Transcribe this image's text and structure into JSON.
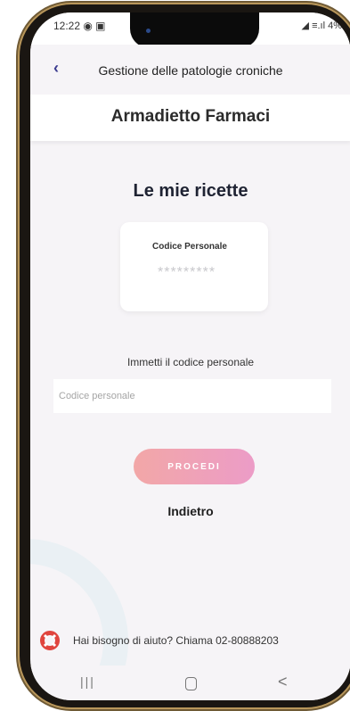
{
  "status_bar": {
    "time": "12:22",
    "indicators": "◉ ▣",
    "right_icons": "◢ ≡.ıl 4%"
  },
  "top_bar": {
    "back_icon": "chevron-left-icon",
    "title": "Gestione delle patologie croniche"
  },
  "header": {
    "title": "Armadietto Farmaci"
  },
  "main": {
    "title": "Le mie ricette",
    "code_card": {
      "label": "Codice Personale",
      "masked_value": "*********"
    },
    "instruction": "Immetti il codice personale",
    "input": {
      "placeholder": "Codice personale",
      "value": ""
    },
    "proceed_label": "PROCEDI",
    "back_label": "Indietro"
  },
  "help": {
    "icon": "lifebuoy-icon",
    "text": "Hai bisogno di aiuto? Chiama 02-80888203"
  },
  "nav_bar": {
    "recents_icon": "|||",
    "home_icon": "home-icon",
    "back_icon": "<"
  },
  "colors": {
    "accent_start": "#f2a7a7",
    "accent_end": "#ec9cc7",
    "back_chevron": "#3b3b8f",
    "lifebuoy_red": "#e0453e",
    "phone_gold": "#b9975b"
  }
}
